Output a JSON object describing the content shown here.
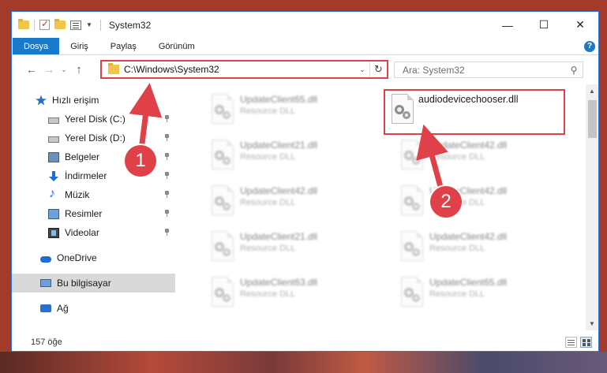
{
  "window": {
    "title": "System32",
    "controls": {
      "minimize": "—",
      "maximize": "☐",
      "close": "✕"
    }
  },
  "ribbon": {
    "tabs": [
      "Dosya",
      "Giriş",
      "Paylaş",
      "Görünüm"
    ],
    "active_tab": "Dosya",
    "help": "?"
  },
  "address": {
    "path": "C:\\Windows\\System32",
    "refresh": "↻",
    "dropdown": "⌄"
  },
  "search": {
    "placeholder": "Ara: System32",
    "icon": "⚲"
  },
  "nav": {
    "back": "←",
    "forward": "→",
    "recent": "⌄",
    "up": "↑"
  },
  "sidebar": {
    "items": [
      {
        "label": "Hızlı erişim",
        "icon": "star-icon",
        "pinned": false
      },
      {
        "label": "Yerel Disk (C:)",
        "icon": "disk-icon",
        "pinned": true
      },
      {
        "label": "Yerel Disk (D:)",
        "icon": "disk-icon",
        "pinned": true
      },
      {
        "label": "Belgeler",
        "icon": "documents-icon",
        "pinned": true
      },
      {
        "label": "İndirmeler",
        "icon": "download-icon",
        "pinned": true
      },
      {
        "label": "Müzik",
        "icon": "music-icon",
        "pinned": true
      },
      {
        "label": "Resimler",
        "icon": "pictures-icon",
        "pinned": true
      },
      {
        "label": "Videolar",
        "icon": "videos-icon",
        "pinned": true
      },
      {
        "label": "OneDrive",
        "icon": "cloud-icon",
        "pinned": false
      },
      {
        "label": "Bu bilgisayar",
        "icon": "computer-icon",
        "pinned": false,
        "selected": true
      },
      {
        "label": "Ağ",
        "icon": "network-icon",
        "pinned": false
      }
    ]
  },
  "files": [
    {
      "name": "UpdateClient65.dll",
      "desc": "Resource DLL"
    },
    {
      "name": "audiodevicechooser.dll",
      "desc": ""
    },
    {
      "name": "UpdateClient21.dll",
      "desc": "Resource DLL"
    },
    {
      "name": "UpdateClient42.dll",
      "desc": "Resource DLL"
    },
    {
      "name": "UpdateClient42.dll",
      "desc": "Resource DLL"
    },
    {
      "name": "UpdateClient42.dll",
      "desc": "Resource DLL"
    },
    {
      "name": "UpdateClient21.dll",
      "desc": "Resource DLL"
    },
    {
      "name": "UpdateClient42.dll",
      "desc": "Resource DLL"
    },
    {
      "name": "UpdateClient63.dll",
      "desc": "Resource DLL"
    },
    {
      "name": "UpdateClient65.dll",
      "desc": "Resource DLL"
    }
  ],
  "status": {
    "count": "157 öğe"
  },
  "annotations": {
    "step1": "1",
    "step2": "2",
    "color": "#e04048"
  }
}
